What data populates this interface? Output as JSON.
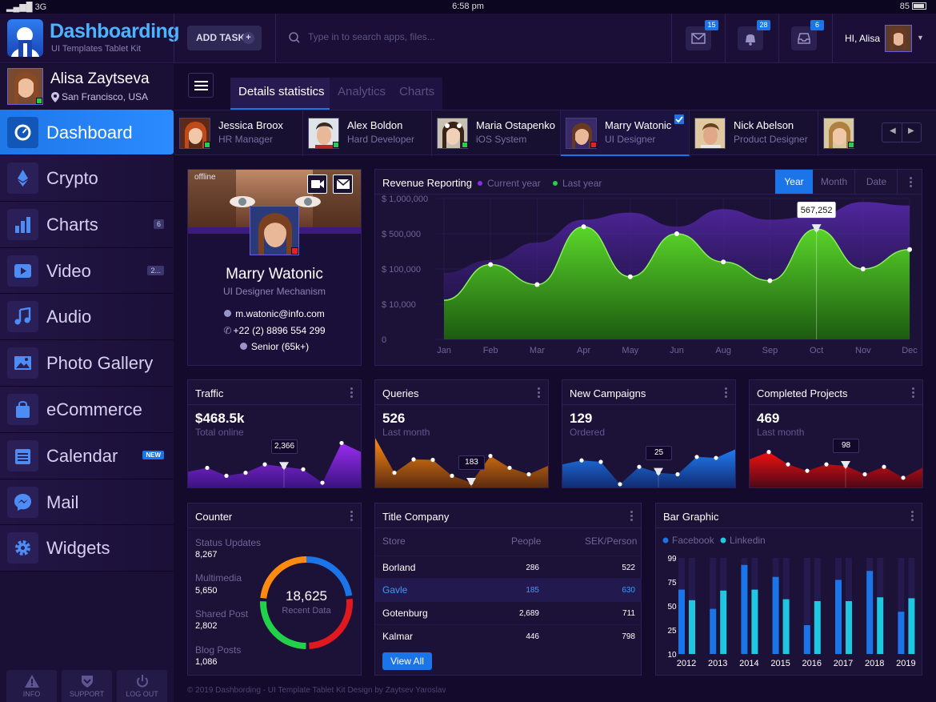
{
  "status_bar": {
    "signal": "3G",
    "time": "6:58 pm",
    "battery": "85"
  },
  "header": {
    "brand": "Dashboarding",
    "brand_sub": "UI Templates Tablet Kit",
    "add_task": "ADD TASK",
    "search_placeholder": "Type in to search apps, files...",
    "mail_count": "15",
    "alerts_count": "28",
    "inbox_count": "6",
    "greeting": "HI, Alisa"
  },
  "user": {
    "name": "Alisa Zaytseva",
    "location": "San Francisco, USA"
  },
  "nav": [
    {
      "label": "Dashboard",
      "icon": "speedometer-icon",
      "badge": ""
    },
    {
      "label": "Crypto",
      "icon": "ethereum-icon",
      "badge": ""
    },
    {
      "label": "Charts",
      "icon": "bar-chart-icon",
      "badge": "6"
    },
    {
      "label": "Video",
      "icon": "play-icon",
      "badge": "2..."
    },
    {
      "label": "Audio",
      "icon": "music-note-icon",
      "badge": ""
    },
    {
      "label": "Photo Gallery",
      "icon": "image-icon",
      "badge": ""
    },
    {
      "label": "eCommerce",
      "icon": "shopping-bag-icon",
      "badge": ""
    },
    {
      "label": "Calendar",
      "icon": "calendar-icon",
      "badge": "NEW"
    },
    {
      "label": "Mail",
      "icon": "messenger-icon",
      "badge": ""
    },
    {
      "label": "Widgets",
      "icon": "gear-icon",
      "badge": ""
    }
  ],
  "footer_buttons": {
    "info": "INFO",
    "support": "SUPPORT",
    "logout": "LOG OUT"
  },
  "tabs": [
    "Details statistics",
    "Analytics",
    "Charts"
  ],
  "people": [
    {
      "name": "Jessica Broox",
      "role": "HR Manager"
    },
    {
      "name": "Alex Boldon",
      "role": "Hard Developer"
    },
    {
      "name": "Maria Ostapenko",
      "role": "iOS System"
    },
    {
      "name": "Marry Watonic",
      "role": "UI Designer"
    },
    {
      "name": "Nick Abelson",
      "role": "Product Designer"
    }
  ],
  "profile": {
    "status": "offline",
    "name": "Marry Watonic",
    "title": "UI Designer Mechanism",
    "email": "m.watonic@info.com",
    "phone": "+22 (2) 8896 554 299",
    "level": "Senior (65k+)"
  },
  "revenue": {
    "title": "Revenue Reporting",
    "legend_current": "Current year",
    "legend_last": "Last year",
    "segments": [
      "Year",
      "Month",
      "Date"
    ],
    "tooltip": "567,252"
  },
  "mini_cards": [
    {
      "title": "Traffic",
      "value": "$468.5k",
      "label": "Total online",
      "tip": "2,366",
      "color_top": "#9a2cf0",
      "color_bottom": "#3a1380"
    },
    {
      "title": "Queries",
      "value": "526",
      "label": "Last month",
      "tip": "183",
      "color_top": "#ff8a10",
      "color_bottom": "#5a2a10"
    },
    {
      "title": "New Campaigns",
      "value": "129",
      "label": "Ordered",
      "tip": "25",
      "color_top": "#1f7bf0",
      "color_bottom": "#102a70"
    },
    {
      "title": "Completed Projects",
      "value": "469",
      "label": "Last month",
      "tip": "98",
      "color_top": "#f01010",
      "color_bottom": "#4a0818"
    }
  ],
  "counter": {
    "title": "Counter",
    "items": [
      {
        "label": "Status Updates",
        "value": "8,267"
      },
      {
        "label": "Multimedia",
        "value": "5,650"
      },
      {
        "label": "Shared Post",
        "value": "2,802"
      },
      {
        "label": "Blog Posts",
        "value": "1,086"
      }
    ],
    "total": "18,625",
    "total_label": "Recent Data"
  },
  "company_table": {
    "title": "Title Company",
    "headers": [
      "Store",
      "People",
      "SEK/Person"
    ],
    "rows": [
      {
        "store": "Borland",
        "people": "286",
        "sek": "522"
      },
      {
        "store": "Gavle",
        "people": "185",
        "sek": "630"
      },
      {
        "store": "Gotenburg",
        "people": "2,689",
        "sek": "711"
      },
      {
        "store": "Kalmar",
        "people": "446",
        "sek": "798"
      }
    ],
    "button": "View All"
  },
  "chart_data": [
    {
      "type": "area",
      "title": "Revenue Reporting",
      "x": [
        "Jan",
        "Feb",
        "Mar",
        "Apr",
        "May",
        "Jun",
        "Aug",
        "Sep",
        "Oct",
        "Nov",
        "Dec"
      ],
      "y_ticks": [
        "$ 1,000,000",
        "$ 500,000",
        "$ 100,000",
        "$ 10,000",
        "0"
      ],
      "series": [
        {
          "name": "Current year",
          "values": [
            20000,
            150000,
            60000,
            600000,
            80000,
            500000,
            180000,
            70000,
            567252,
            100000,
            320000
          ]
        },
        {
          "name": "Last year",
          "values": [
            90000,
            200000,
            400000,
            700000,
            800000,
            600000,
            850000,
            700000,
            750000,
            950000,
            900000
          ]
        }
      ]
    },
    {
      "type": "bar",
      "title": "Bar Graphic",
      "categories": [
        "2012",
        "2013",
        "2014",
        "2015",
        "2016",
        "2017",
        "2018",
        "2019"
      ],
      "y_ticks": [
        "99",
        "75",
        "50",
        "25",
        "10"
      ],
      "series": [
        {
          "name": "Facebook",
          "values": [
            67,
            47,
            92,
            80,
            30,
            77,
            86,
            44
          ]
        },
        {
          "name": "Linkedin",
          "values": [
            56,
            66,
            67,
            57,
            55,
            55,
            59,
            58
          ]
        }
      ]
    }
  ],
  "copyright": "© 2019 Dashbording - UI Template Tablet Kit Design by Zaytsev Yaroslav"
}
